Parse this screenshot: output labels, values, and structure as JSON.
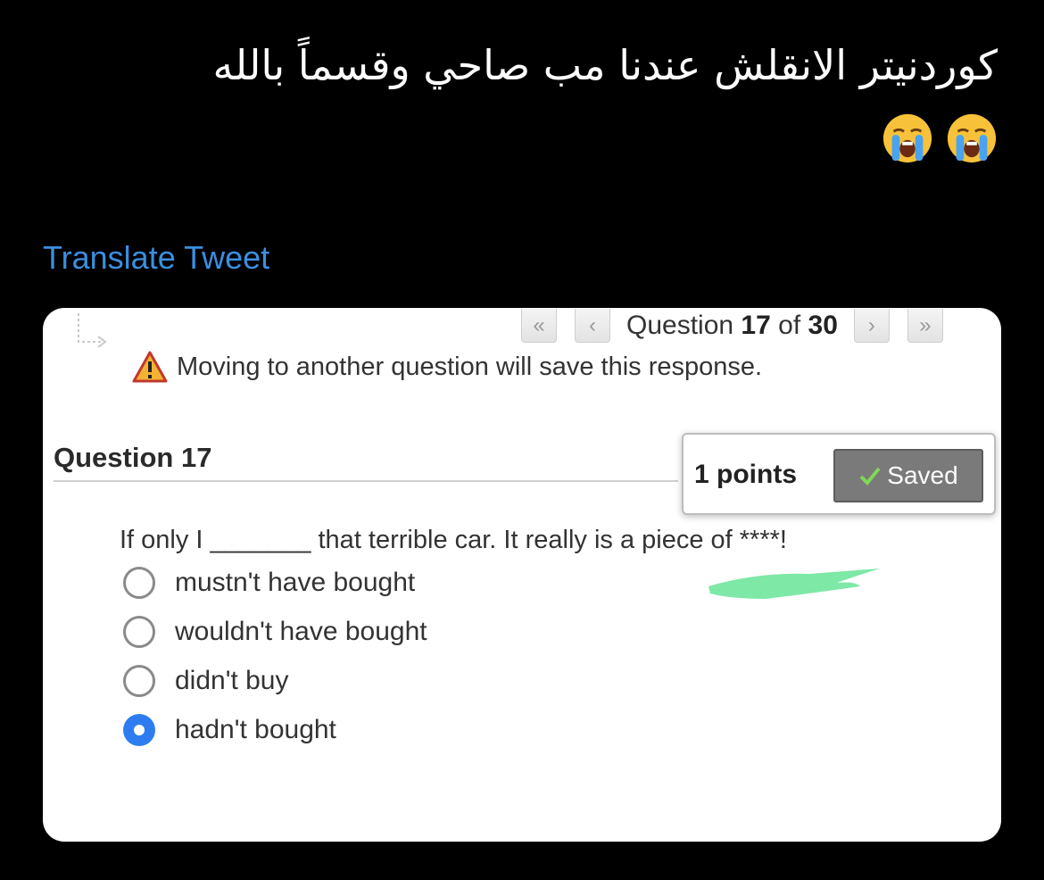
{
  "tweet": {
    "text": "كوردنيتر الانقلش عندنا مب صاحي وقسماً بالله",
    "emoji_icons": [
      "loudly-crying-face-icon",
      "loudly-crying-face-icon"
    ],
    "translate_label": "Translate Tweet",
    "link_color": "#3b8fe0"
  },
  "quiz": {
    "nav": {
      "first_icon": "«",
      "prev_icon": "‹",
      "question_word": "Question",
      "current": "17",
      "of_word": "of",
      "total": "30",
      "next_icon": "›",
      "last_icon": "»"
    },
    "warning": "Moving to another question will save this response.",
    "question_title": "Question 17",
    "points": "1 points",
    "saved_label": "Saved",
    "prompt": "If only I _______ that terrible car. It really is a piece of ****!",
    "options": [
      {
        "label": "mustn't have bought",
        "selected": false
      },
      {
        "label": "wouldn't have bought",
        "selected": false
      },
      {
        "label": "didn't buy",
        "selected": false
      },
      {
        "label": "hadn't bought",
        "selected": true
      }
    ],
    "accent_color": "#2d7df0",
    "highlight_color": "#7ee8a6"
  }
}
